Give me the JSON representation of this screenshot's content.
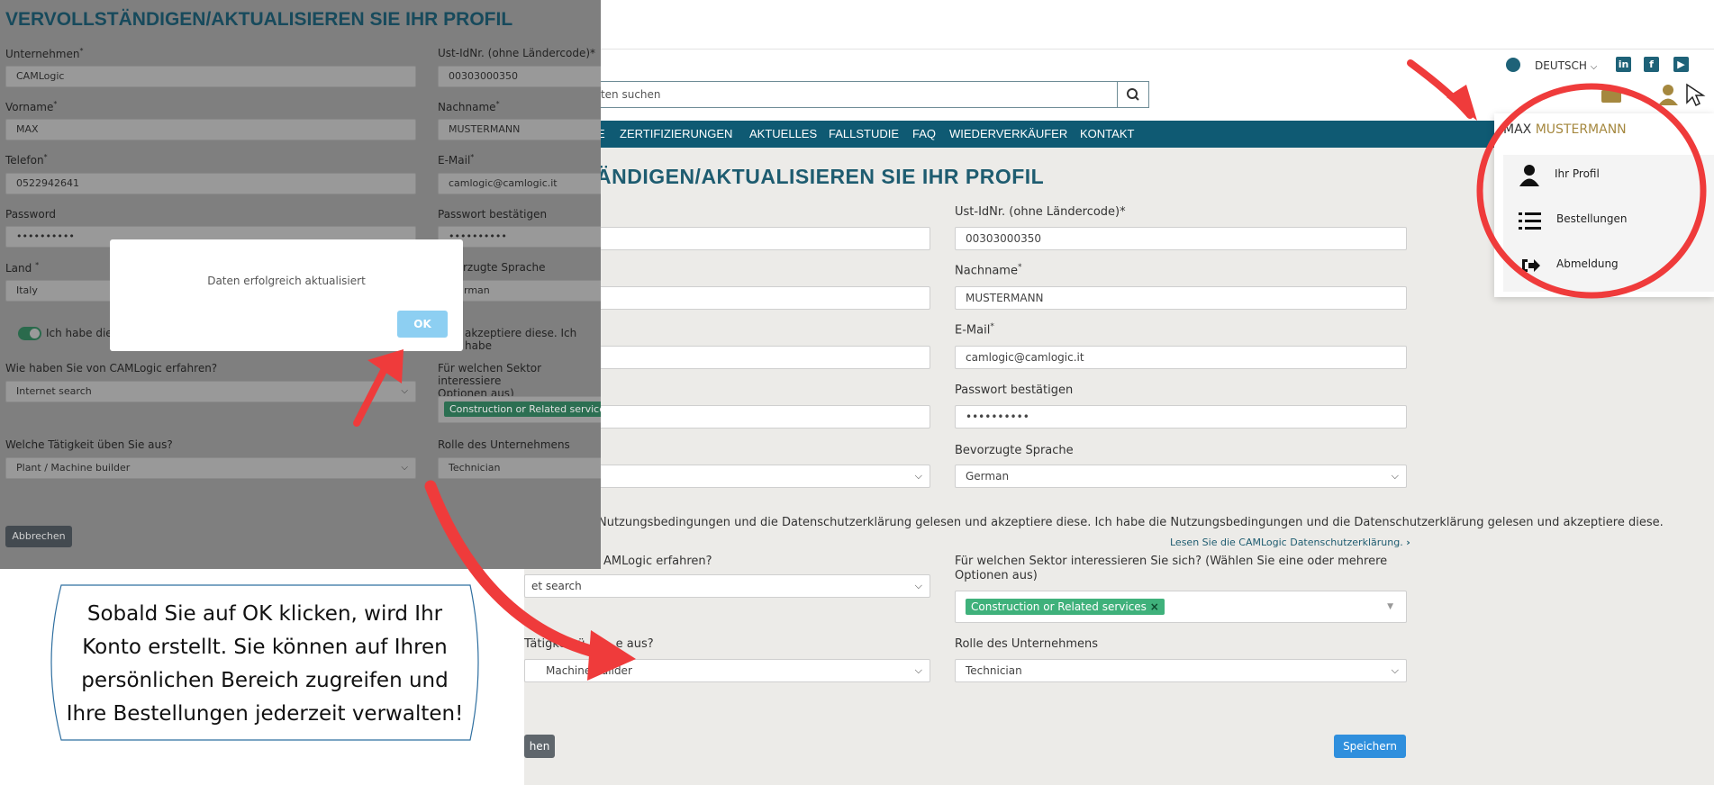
{
  "right": {
    "language": "DEUTSCH",
    "search_placeholder": "kten suchen",
    "nav": [
      "E",
      "ZERTIFIZIERUNGEN",
      "AKTUELLES",
      "FALLSTUDIE",
      "FAQ",
      "WIEDERVERKÄUFER",
      "KONTAKT"
    ],
    "title": "ÄNDIGEN/AKTUALISIEREN SIE IHR PROFIL",
    "vat_label": "Ust-IdNr. (ohne Ländercode)*",
    "vat_value": "00303000350",
    "lastname_label": "Nachname",
    "lastname_value": "MUSTERMANN",
    "email_label": "E-Mail",
    "email_value": "camlogic@camlogic.it",
    "confirm_pw_label": "Passwort bestätigen",
    "confirm_pw_value": "••••••••••",
    "lang_pref_label": "Bevorzugte Sprache",
    "lang_pref_value": "German",
    "terms_text": "Nutzungsbedingungen und die Datenschutzerklärung gelesen und akzeptiere diese. Ich habe die Nutzungsbedingungen und die Datenschutzerklärung gelesen und akzeptiere diese.",
    "privacy_link": "Lesen Sie die CAMLogic Datenschutzerklärung.",
    "source_label_partial": "AMLogic erfahren?",
    "source_value_partial": "et search",
    "sector_label": "Für welchen Sektor interessieren Sie sich? (Wählen Sie eine oder mehrere Optionen aus)",
    "sector_tag": "Construction or Related services",
    "activity_label_partial": "Tätigkeit ü",
    "activity_label_end": "e aus?",
    "activity_value_partial": "Machine builder",
    "role_label": "Rolle des Unternehmens",
    "role_value": "Technician",
    "cancel_partial": "hen",
    "save_label": "Speichern"
  },
  "user_menu": {
    "first_name": "MAX",
    "last_name": "MUSTERMANN",
    "items": [
      "Ihr Profil",
      "Bestellungen",
      "Abmeldung"
    ]
  },
  "left": {
    "title": "VERVOLLSTÄNDIGEN/AKTUALISIEREN SIE IHR PROFIL",
    "company_label": "Unternehmen",
    "company_value": "CAMLogic",
    "vat_label": "Ust-IdNr. (ohne Ländercode)*",
    "vat_value": "00303000350",
    "firstname_label": "Vorname",
    "firstname_value": "MAX",
    "lastname_label": "Nachname",
    "lastname_value": "MUSTERMANN",
    "phone_label": "Telefon",
    "phone_value": "0522942641",
    "email_label": "E-Mail",
    "email_value": "camlogic@camlogic.it",
    "password_label": "Password",
    "password_value": "••••••••••",
    "confirm_pw_label": "Passwort bestätigen",
    "confirm_pw_value": "••••••••••",
    "country_label": "Land",
    "country_value": "Italy",
    "lang_pref_label_partial": "rzugte Sprache",
    "lang_pref_value_partial": "rman",
    "terms_toggle_partial": "Ich habe die",
    "terms_right_partial": "akzeptiere diese. Ich habe",
    "source_label": "Wie haben Sie von CAMLogic erfahren?",
    "source_value": "Internet search",
    "sector_label_partial": "Für welchen Sektor interessiere",
    "sector_label_partial2": "Optionen aus)",
    "sector_tag": "Construction or Related services",
    "activity_label": "Welche Tätigkeit üben Sie aus?",
    "activity_value": "Plant / Machine builder",
    "role_label": "Rolle des Unternehmens",
    "role_value": "Technician",
    "cancel_label": "Abbrechen"
  },
  "dialog": {
    "message": "Daten erfolgreich aktualisiert",
    "ok_label": "OK"
  },
  "bubble": {
    "lines": [
      "Sobald Sie auf OK klicken, wird Ihr",
      "Konto erstellt. Sie können auf Ihren",
      "persönlichen Bereich zugreifen und",
      "Ihre Bestellungen jederzeit verwalten!"
    ]
  },
  "colors": {
    "nav": "#0f5a73",
    "title": "#1e5c70",
    "accent_gold": "#a5883f",
    "tag_green": "#3fb17b",
    "save_blue": "#2f8fdd",
    "annotation_red": "#ef3b3b"
  }
}
